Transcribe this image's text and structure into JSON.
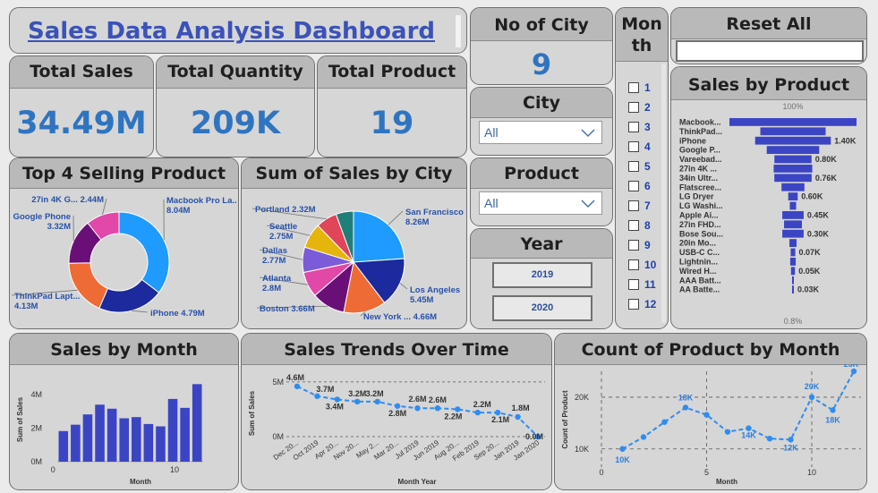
{
  "title": "Sales Data Analysis Dashboard",
  "kpis": {
    "total_sales": {
      "label": "Total Sales",
      "value": "34.49M"
    },
    "total_quantity": {
      "label": "Total Quantity",
      "value": "209K"
    },
    "total_product": {
      "label": "Total Product",
      "value": "19"
    },
    "no_of_city": {
      "label": "No of City",
      "value": "9"
    }
  },
  "filters": {
    "city": {
      "label": "City",
      "value": "All"
    },
    "product": {
      "label": "Product",
      "value": "All"
    },
    "year": {
      "label": "Year",
      "options": [
        "2019",
        "2020"
      ]
    },
    "month": {
      "label_line1": "Mon",
      "label_line2": "th",
      "options": [
        "1",
        "2",
        "3",
        "4",
        "5",
        "6",
        "7",
        "8",
        "9",
        "10",
        "11",
        "12"
      ]
    },
    "reset_label": "Reset All"
  },
  "colors": {
    "accent": "#2f74c0",
    "bar": "#3b45c4",
    "line": "#2f8cf0",
    "header_bg": "#b9b9b9",
    "card_bg": "#d6d6d6"
  },
  "chart_data": [
    {
      "id": "top4",
      "type": "pie",
      "title": "Top 4 Selling Product",
      "variant": "donut",
      "slices": [
        {
          "label": "Macbook Pro La...",
          "value_label": "8.04M",
          "value": 8.04,
          "color": "#1f9bff"
        },
        {
          "label": "iPhone",
          "value_label": "4.79M",
          "value": 4.79,
          "color": "#1c2a9e"
        },
        {
          "label": "ThinkPad Lapt...",
          "value_label": "4.13M",
          "value": 4.13,
          "color": "#ee6b36"
        },
        {
          "label": "Google Phone",
          "value_label": "3.32M",
          "value": 3.32,
          "color": "#6b0f78"
        },
        {
          "label": "27in 4K G...",
          "value_label": "2.44M",
          "value": 2.44,
          "color": "#e148a7"
        }
      ]
    },
    {
      "id": "city",
      "type": "pie",
      "title": "Sum of Sales by City",
      "slices": [
        {
          "label": "San Francisco",
          "value_label": "8.26M",
          "value": 8.26,
          "color": "#1f9bff"
        },
        {
          "label": "Los Angeles",
          "value_label": "5.45M",
          "value": 5.45,
          "color": "#1c2a9e"
        },
        {
          "label": "New York ...",
          "value_label": "4.66M",
          "value": 4.66,
          "color": "#ee6b36"
        },
        {
          "label": "Boston",
          "value_label": "3.66M",
          "value": 3.66,
          "color": "#6b0f78"
        },
        {
          "label": "Atlanta",
          "value_label": "2.8M",
          "value": 2.8,
          "color": "#e148a7"
        },
        {
          "label": "Dallas",
          "value_label": "2.77M",
          "value": 2.77,
          "color": "#7b5bd8"
        },
        {
          "label": "Seattle",
          "value_label": "2.75M",
          "value": 2.75,
          "color": "#e6b50d"
        },
        {
          "label": "Portland",
          "value_label": "2.32M",
          "value": 2.32,
          "color": "#e0455a"
        },
        {
          "label": "",
          "value_label": "",
          "value": 1.93,
          "color": "#1e7f7a"
        }
      ]
    },
    {
      "id": "product",
      "type": "bar",
      "title": "Sales by Product",
      "orientation": "funnel",
      "top_label": "100%",
      "bottom_label": "0.8%",
      "categories": [
        "Macbook...",
        "ThinkPad...",
        "iPhone",
        "Google P...",
        "Vareebad...",
        "27in 4K ...",
        "34in Ultr...",
        "Flatscree...",
        "LG Dryer",
        "LG Washi...",
        "Apple Ai...",
        "27in FHD...",
        "Bose Sou...",
        "20in Mo...",
        "USB-C C...",
        "Lightnin...",
        "Wired H...",
        "AAA Batt...",
        "AA Batte..."
      ],
      "values": [
        8.04,
        4.13,
        4.79,
        3.32,
        2.35,
        2.44,
        2.36,
        1.45,
        0.6,
        0.4,
        1.35,
        1.13,
        1.35,
        0.45,
        0.29,
        0.35,
        0.25,
        0.09,
        0.11
      ],
      "data_labels": [
        "",
        "",
        "1.40K",
        "",
        "0.80K",
        "",
        "0.76K",
        "",
        "0.60K",
        "",
        "0.45K",
        "",
        "0.30K",
        "",
        "0.07K",
        "",
        "0.05K",
        "",
        "0.03K"
      ]
    },
    {
      "id": "month",
      "type": "bar",
      "title": "Sales by Month",
      "xlabel": "Month",
      "ylabel": "Sum of Sales",
      "y_ticks": [
        "0M",
        "2M",
        "4M"
      ],
      "x_ticks": [
        "0",
        "10"
      ],
      "ylim": [
        0,
        5
      ],
      "categories": [
        1,
        2,
        3,
        4,
        5,
        6,
        7,
        8,
        9,
        10,
        11,
        12
      ],
      "values": [
        1.82,
        2.2,
        2.81,
        3.39,
        3.15,
        2.58,
        2.65,
        2.24,
        2.1,
        3.73,
        3.2,
        4.61
      ]
    },
    {
      "id": "trend",
      "type": "line",
      "title": "Sales Trends Over Time",
      "xlabel": "Month Year",
      "ylabel": "Sum of Sales",
      "y_ticks": [
        "0M",
        "5M"
      ],
      "ylim": [
        0,
        5.4
      ],
      "x_tick_labels": [
        "Dec 20...",
        "Oct 2019",
        "Apr 20...",
        "Nov 20...",
        "May 2...",
        "Mar 20...",
        "Jul 2019",
        "Jun 2019",
        "Aug 20...",
        "Feb 2019",
        "Sep 20...",
        "Jan 2019",
        "Jan 2020"
      ],
      "values": [
        4.6,
        3.7,
        3.4,
        3.2,
        3.2,
        2.8,
        2.6,
        2.6,
        2.5,
        2.2,
        2.2,
        1.8,
        0.0
      ],
      "point_labels": [
        "4.6M",
        "3.7M",
        "3.4M",
        "3.2M",
        "3.2M",
        "2.8M",
        "2.6M",
        "2.6M",
        "2.2M",
        "2.2M",
        "2.1M",
        "1.8M",
        "0.0M"
      ]
    },
    {
      "id": "count",
      "type": "line",
      "title": "Count of Product by Month",
      "xlabel": "Month",
      "ylabel": "Count of Product",
      "y_ticks": [
        "10K",
        "20K"
      ],
      "x_ticks": [
        "0",
        "5",
        "10"
      ],
      "ylim": [
        6.5,
        25
      ],
      "x": [
        1,
        2,
        3,
        4,
        5,
        6,
        7,
        8,
        9,
        10,
        11,
        12
      ],
      "values": [
        10,
        12.3,
        15.2,
        18,
        16.6,
        13.3,
        14,
        12,
        11.8,
        20,
        17.5,
        25
      ],
      "point_labels": [
        "10K",
        "",
        "",
        "18K",
        "",
        "",
        "14K",
        "",
        "12K",
        "20K",
        "18K",
        "25K"
      ]
    }
  ]
}
